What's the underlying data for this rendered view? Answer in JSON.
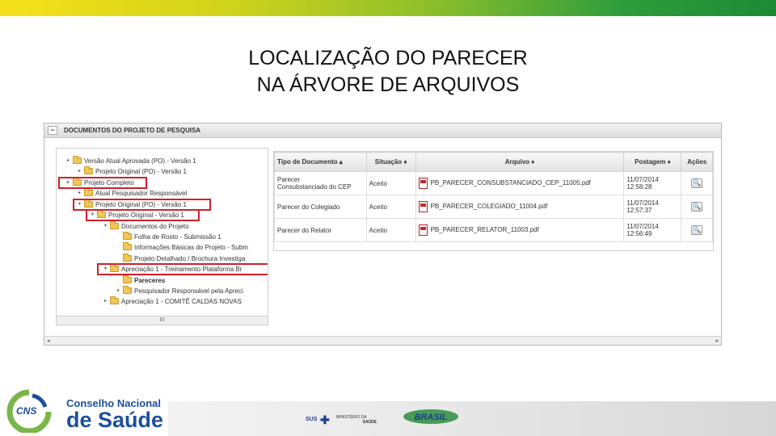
{
  "slide": {
    "title_line1": "LOCALIZAÇÃO DO PARECER",
    "title_line2": "NA ÁRVORE DE ARQUIVOS"
  },
  "panel": {
    "collapse_symbol": "−",
    "header": "DOCUMENTOS DO PROJETO DE PESQUISA"
  },
  "tree": {
    "items": [
      {
        "toggle": "▸",
        "label": "Versão Atual Aprovada (PO) - Versão 1"
      },
      {
        "toggle": "▸",
        "label": "Projeto Original (PO) - Versão 1"
      },
      {
        "toggle": "▸",
        "label": "Projeto Completo"
      },
      {
        "toggle": "▸",
        "label": "Atual Pesquisador Responsável"
      },
      {
        "toggle": "▾",
        "label": "Projeto Original (PO) - Versão 1"
      },
      {
        "toggle": "▾",
        "label": "Projeto Original - Versão 1"
      },
      {
        "toggle": "▾",
        "label": "Documentos do Projeto"
      },
      {
        "toggle": "",
        "label": "Folha de Rosto - Submissão 1"
      },
      {
        "toggle": "",
        "label": "Informações Básicas do Projeto - Subm"
      },
      {
        "toggle": "",
        "label": "Projeto Detalhado / Brochura Investiga"
      },
      {
        "toggle": "▾",
        "label": "Apreciação 1 - Treinamento Plataforma Br"
      },
      {
        "toggle": "",
        "label": "Pareceres"
      },
      {
        "toggle": "▸",
        "label": "Pesquisador Responsável pela Apreci"
      },
      {
        "toggle": "▸",
        "label": "Apreciação 1 - COMITÊ CALDAS NOVAS"
      }
    ],
    "scroll_label": "III"
  },
  "table": {
    "headers": {
      "tipo": "Tipo de Documento",
      "situacao": "Situação",
      "arquivo": "Arquivo",
      "postagem": "Postagem",
      "acoes": "Ações"
    },
    "rows": [
      {
        "tipo_l1": "Parecer",
        "tipo_l2": "Consubstanciado do CEP",
        "situacao": "Aceito",
        "arquivo": "PB_PARECER_CONSUBSTANCIADO_CEP_11005.pdf",
        "data": "11/07/2014",
        "hora": "12:58:28"
      },
      {
        "tipo_l1": "Parecer do Colegiado",
        "tipo_l2": "",
        "situacao": "Aceito",
        "arquivo": "PB_PARECER_COLEGIADO_11004.pdf",
        "data": "11/07/2014",
        "hora": "12:57:37"
      },
      {
        "tipo_l1": "Parecer do Relator",
        "tipo_l2": "",
        "situacao": "Aceito",
        "arquivo": "PB_PARECER_RELATOR_11003.pdf",
        "data": "11/07/2014",
        "hora": "12:56:49"
      }
    ],
    "action_glyph": "🔍"
  },
  "footer": {
    "cns_abbrev": "CNS",
    "cns_line1": "Conselho Nacional",
    "cns_line2": "de Saúde",
    "sus": "SUS",
    "ms_line1": "MINISTÉRIO DA",
    "ms_line2": "SAÚDE",
    "brasil": "BRASIL"
  },
  "colors": {
    "highlight": "#d0202a",
    "cns_blue": "#1e4f9c",
    "cns_green": "#7ab648",
    "folder": "#f1c757"
  }
}
